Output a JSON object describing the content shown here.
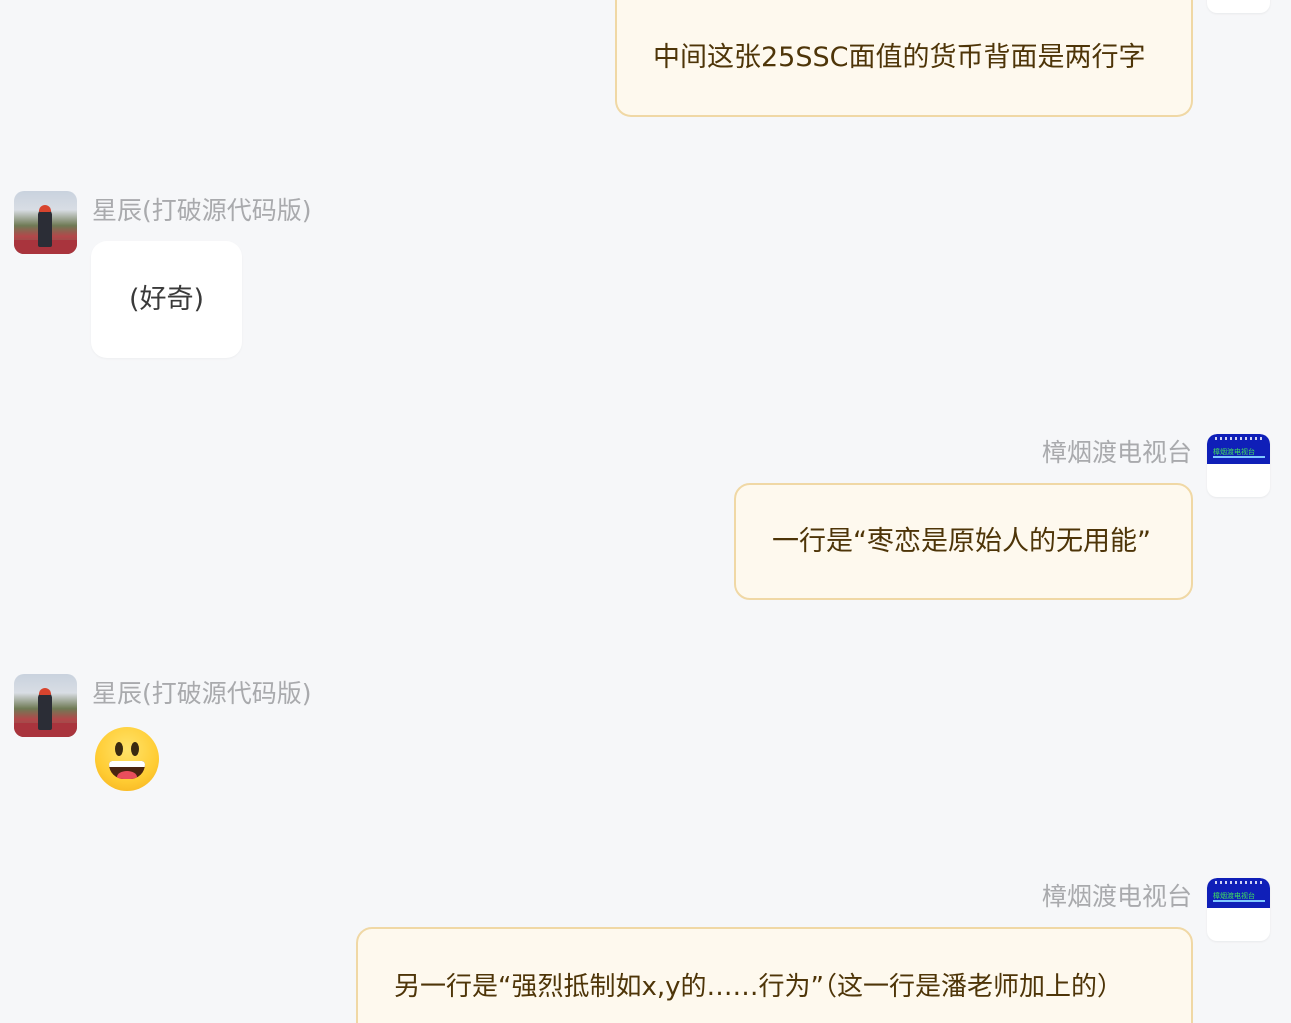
{
  "contacts": {
    "other_name": "星辰(打破源代码版)",
    "self_name": "樟烟渡电视台",
    "self_avatar_text": "樟烟渡电视台"
  },
  "messages": [
    {
      "sender": "self",
      "text": "中间这张25SSC面值的货币背面是两行字"
    },
    {
      "sender": "other",
      "text": "(好奇)"
    },
    {
      "sender": "self",
      "text": "一行是“枣恋是原始人的无用能”"
    },
    {
      "sender": "other",
      "emoji": "grinning-face"
    },
    {
      "sender": "self",
      "text": "另一行是“强烈抵制如x,y的……行为”（这一行是潘老师加上的）"
    }
  ],
  "colors": {
    "background": "#f6f7f9",
    "self_bubble_bg": "#fef9ee",
    "self_bubble_border": "#f0d8a5",
    "self_text": "#4e3508",
    "other_bubble_bg": "#ffffff",
    "name_text": "#a9aaad"
  }
}
